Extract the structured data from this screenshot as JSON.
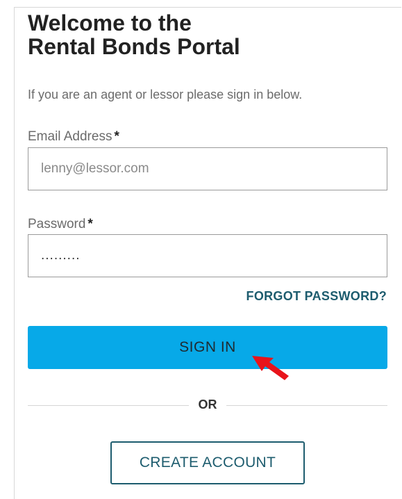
{
  "header": {
    "title_line1": "Welcome to the",
    "title_line2": "Rental Bonds Portal"
  },
  "intro_text": "If you are an agent or lessor please sign in below.",
  "form": {
    "email": {
      "label": "Email Address",
      "required_mark": "*",
      "value": "lenny@lessor.com"
    },
    "password": {
      "label": "Password",
      "required_mark": "*",
      "value": "........."
    },
    "forgot_password_label": "FORGOT PASSWORD?",
    "sign_in_label": "SIGN IN"
  },
  "divider_text": "OR",
  "create_account_label": "CREATE ACCOUNT",
  "annotation": {
    "icon": "red-arrow-pointer-icon",
    "color": "#e8141b"
  },
  "colors": {
    "primary_button": "#07a9e8",
    "accent": "#1d5c6e",
    "text_dark": "#222222",
    "text_muted": "#6b6b6b"
  }
}
